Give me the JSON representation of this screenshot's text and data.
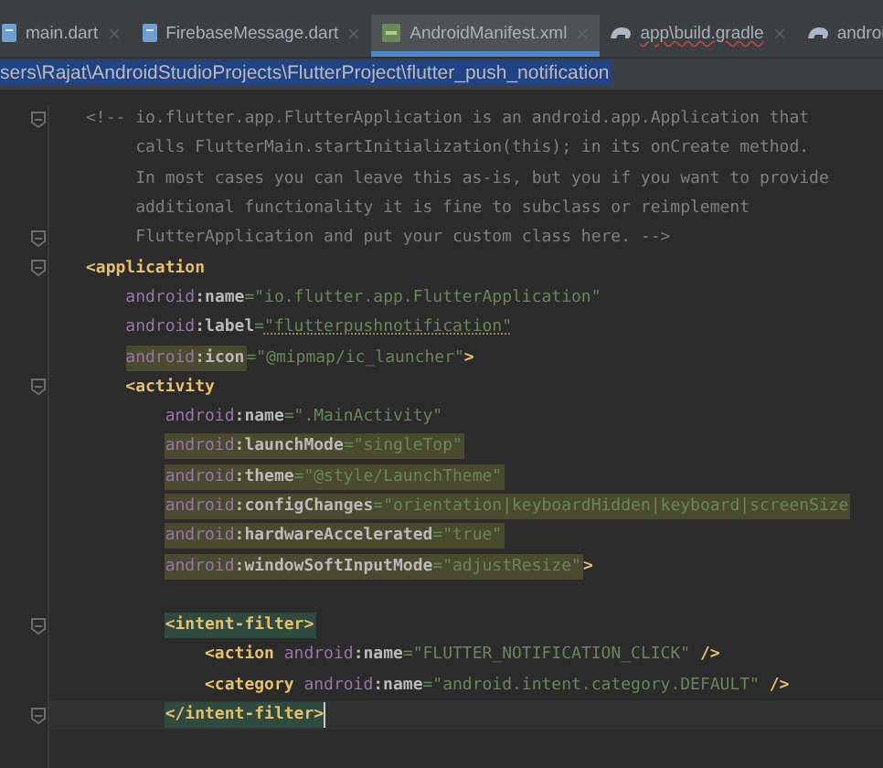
{
  "tabs": [
    {
      "label": "main.dart",
      "kind": "dart",
      "selected": false
    },
    {
      "label": "FirebaseMessage.dart",
      "kind": "dart",
      "selected": false
    },
    {
      "label": "AndroidManifest.xml",
      "kind": "xml",
      "selected": true
    },
    {
      "label": "app\\build.gradle",
      "kind": "gradle",
      "selected": false
    },
    {
      "label": "androi",
      "kind": "gradle",
      "selected": false
    }
  ],
  "breadcrumb": {
    "path": "sers\\Rajat\\AndroidStudioProjects\\FlutterProject\\flutter_push_notification",
    "selected": true
  },
  "lines": [
    {
      "fold": true,
      "caret": false,
      "segments": [
        {
          "highlighted": false,
          "tokens": [
            {
              "kind": "comment",
              "text": "<!-- io.flutter.app.FlutterApplication is an android.app.Application that"
            }
          ]
        }
      ],
      "children": [
        {
          "fold": false,
          "caret": false,
          "segments": [
            {
              "highlighted": false,
              "tokens": [
                {
                  "kind": "comment",
                  "text": "calls FlutterMain.startInitialization(this); in its onCreate method."
                }
              ]
            }
          ]
        },
        {
          "fold": false,
          "caret": false,
          "segments": [
            {
              "highlighted": false,
              "tokens": [
                {
                  "kind": "comment",
                  "text": "In most cases you can leave this as-is, but you if you want to provide"
                }
              ]
            }
          ]
        },
        {
          "fold": false,
          "caret": false,
          "segments": [
            {
              "highlighted": false,
              "tokens": [
                {
                  "kind": "comment",
                  "text": "additional functionality it is fine to subclass or reimplement"
                }
              ]
            }
          ]
        },
        {
          "fold": true,
          "caret": false,
          "segments": [
            {
              "highlighted": false,
              "tokens": [
                {
                  "kind": "comment",
                  "text": "FlutterApplication and put your custom class here. -->"
                }
              ]
            }
          ]
        }
      ]
    },
    {
      "fold": true,
      "caret": false,
      "segments": [
        {
          "highlighted": false,
          "tokens": [
            {
              "kind": "tag",
              "text": "<application"
            }
          ]
        }
      ],
      "children": [
        {
          "fold": false,
          "caret": false,
          "segments": [
            {
              "highlighted": false,
              "tokens": [
                {
                  "kind": "ns",
                  "text": "android"
                },
                {
                  "kind": "attr",
                  "text": ":name"
                },
                {
                  "kind": "eq",
                  "text": "="
                },
                {
                  "kind": "value",
                  "text": "\"io.flutter.app.FlutterApplication\""
                }
              ]
            }
          ]
        },
        {
          "fold": false,
          "caret": false,
          "segments": [
            {
              "highlighted": false,
              "tokens": [
                {
                  "kind": "ns",
                  "text": "android"
                },
                {
                  "kind": "attr",
                  "text": ":label"
                },
                {
                  "kind": "eq",
                  "text": "="
                },
                {
                  "kind": "value-typo",
                  "text": "\"flutterpushnotification\""
                }
              ]
            }
          ]
        },
        {
          "fold": false,
          "caret": false,
          "segments": [
            {
              "highlighted": true,
              "tokens": [
                {
                  "kind": "ns",
                  "text": "android"
                },
                {
                  "kind": "attr",
                  "text": ":icon"
                }
              ]
            },
            {
              "highlighted": false,
              "tokens": [
                {
                  "kind": "eq",
                  "text": "="
                },
                {
                  "kind": "value",
                  "text": "\"@mipmap/ic_launcher\""
                },
                {
                  "kind": "tag",
                  "text": ">"
                }
              ]
            }
          ]
        },
        {
          "fold": true,
          "caret": false,
          "segments": [
            {
              "highlighted": false,
              "tokens": [
                {
                  "kind": "tag",
                  "text": "<activity"
                }
              ]
            }
          ],
          "children": [
            {
              "fold": false,
              "caret": false,
              "segments": [
                {
                  "highlighted": false,
                  "tokens": [
                    {
                      "kind": "ns",
                      "text": "android"
                    },
                    {
                      "kind": "attr",
                      "text": ":name"
                    },
                    {
                      "kind": "eq",
                      "text": "="
                    },
                    {
                      "kind": "value",
                      "text": "\".MainActivity\""
                    }
                  ]
                }
              ]
            },
            {
              "fold": false,
              "caret": false,
              "segments": [
                {
                  "highlighted": true,
                  "tokens": [
                    {
                      "kind": "ns",
                      "text": "android"
                    },
                    {
                      "kind": "attr",
                      "text": ":launchMode"
                    },
                    {
                      "kind": "eq",
                      "text": "="
                    },
                    {
                      "kind": "value",
                      "text": "\"singleTop\""
                    }
                  ]
                }
              ]
            },
            {
              "fold": false,
              "caret": false,
              "segments": [
                {
                  "highlighted": true,
                  "tokens": [
                    {
                      "kind": "ns",
                      "text": "android"
                    },
                    {
                      "kind": "attr",
                      "text": ":theme"
                    },
                    {
                      "kind": "eq",
                      "text": "="
                    },
                    {
                      "kind": "value",
                      "text": "\"@style/LaunchTheme\""
                    }
                  ]
                }
              ]
            },
            {
              "fold": false,
              "caret": false,
              "segments": [
                {
                  "highlighted": true,
                  "tokens": [
                    {
                      "kind": "ns",
                      "text": "android"
                    },
                    {
                      "kind": "attr",
                      "text": ":configChanges"
                    },
                    {
                      "kind": "eq",
                      "text": "="
                    },
                    {
                      "kind": "value",
                      "text": "\"orientation|keyboardHidden|keyboard|screenSize"
                    }
                  ]
                }
              ]
            },
            {
              "fold": false,
              "caret": false,
              "segments": [
                {
                  "highlighted": true,
                  "tokens": [
                    {
                      "kind": "ns",
                      "text": "android"
                    },
                    {
                      "kind": "attr",
                      "text": ":hardwareAccelerated"
                    },
                    {
                      "kind": "eq",
                      "text": "="
                    },
                    {
                      "kind": "value",
                      "text": "\"true\""
                    }
                  ]
                }
              ]
            },
            {
              "fold": false,
              "caret": false,
              "segments": [
                {
                  "highlighted": true,
                  "tokens": [
                    {
                      "kind": "ns",
                      "text": "android"
                    },
                    {
                      "kind": "attr",
                      "text": ":windowSoftInputMode"
                    },
                    {
                      "kind": "eq",
                      "text": "="
                    },
                    {
                      "kind": "value",
                      "text": "\"adjustResize\""
                    }
                  ]
                },
                {
                  "highlighted": false,
                  "tokens": [
                    {
                      "kind": "tag",
                      "text": ">"
                    }
                  ]
                }
              ]
            },
            {
              "fold": true,
              "caret": false,
              "space_before": true,
              "segments": [
                {
                  "highlighted": true,
                  "tokens": [
                    {
                      "kind": "tag",
                      "text": "<intent-filter>"
                    }
                  ]
                }
              ],
              "children": [
                {
                  "fold": false,
                  "caret": false,
                  "segments": [
                    {
                      "highlighted": false,
                      "tokens": [
                        {
                          "kind": "tag",
                          "text": "<action "
                        },
                        {
                          "kind": "ns",
                          "text": "android"
                        },
                        {
                          "kind": "attr",
                          "text": ":name"
                        },
                        {
                          "kind": "eq",
                          "text": "="
                        },
                        {
                          "kind": "value",
                          "text": "\"FLUTTER_NOTIFICATION_CLICK\""
                        },
                        {
                          "kind": "tag",
                          "text": " />"
                        }
                      ]
                    }
                  ]
                },
                {
                  "fold": false,
                  "caret": false,
                  "segments": [
                    {
                      "highlighted": false,
                      "tokens": [
                        {
                          "kind": "tag",
                          "text": "<category "
                        },
                        {
                          "kind": "ns",
                          "text": "android"
                        },
                        {
                          "kind": "attr",
                          "text": ":name"
                        },
                        {
                          "kind": "eq",
                          "text": "="
                        },
                        {
                          "kind": "value",
                          "text": "\"android.intent.category.DEFAULT\""
                        },
                        {
                          "kind": "tag",
                          "text": " />"
                        }
                      ]
                    }
                  ]
                }
              ]
            },
            {
              "fold": true,
              "caret": true,
              "segments": [
                {
                  "highlighted": true,
                  "tokens": [
                    {
                      "kind": "tag",
                      "text": "</intent-filter>"
                    }
                  ]
                }
              ]
            }
          ]
        }
      ]
    }
  ]
}
